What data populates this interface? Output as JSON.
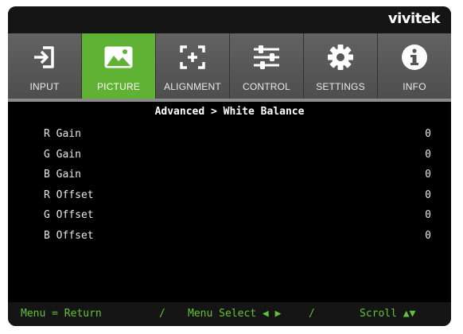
{
  "brand": "vivitek",
  "tabs": [
    {
      "label": "INPUT",
      "icon": "input-icon",
      "active": false
    },
    {
      "label": "PICTURE",
      "icon": "picture-icon",
      "active": true
    },
    {
      "label": "ALIGNMENT",
      "icon": "alignment-icon",
      "active": false
    },
    {
      "label": "CONTROL",
      "icon": "control-icon",
      "active": false
    },
    {
      "label": "SETTINGS",
      "icon": "settings-icon",
      "active": false
    },
    {
      "label": "INFO",
      "icon": "info-icon",
      "active": false
    }
  ],
  "page_title": "Advanced > White Balance",
  "rows": [
    {
      "label": "R Gain",
      "value": "0"
    },
    {
      "label": "G Gain",
      "value": "0"
    },
    {
      "label": "B Gain",
      "value": "0"
    },
    {
      "label": "R Offset",
      "value": "0"
    },
    {
      "label": "G Offset",
      "value": "0"
    },
    {
      "label": "B Offset",
      "value": "0"
    }
  ],
  "footer": {
    "return_hint": "Menu = Return",
    "divider": "/",
    "select_hint": "Menu Select ◀ ▶",
    "scroll_hint": "Scroll ▲▼"
  },
  "colors": {
    "accent_green": "#5fb233",
    "footer_text": "#62c23a",
    "tab_gray": "#5a5a5a"
  }
}
